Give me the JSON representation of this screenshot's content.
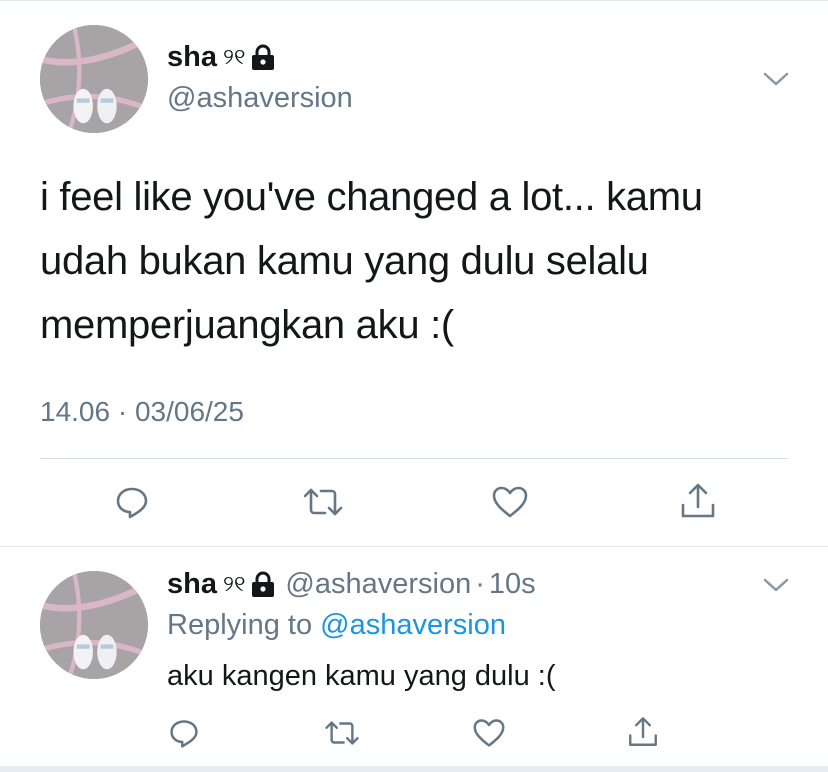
{
  "main_tweet": {
    "display_name": "sha",
    "name_decoration": "୨୧",
    "handle": "@ashaversion",
    "text": "i feel like you've changed a lot... kamu udah bukan kamu yang dulu selalu memperjuangkan aku :(",
    "timestamp": "14.06 · 03/06/25",
    "icons": {
      "lock": "lock-icon",
      "menu": "chevron-down-icon",
      "reply": "reply-icon",
      "retweet": "retweet-icon",
      "like": "heart-icon",
      "share": "share-icon"
    }
  },
  "reply_tweet": {
    "display_name": "sha",
    "name_decoration": "୨୧",
    "handle": "@ashaversion",
    "separator": "·",
    "time_ago": "10s",
    "replying_prefix": "Replying to",
    "replying_to": "@ashaversion",
    "text": "aku kangen kamu yang dulu :("
  },
  "colors": {
    "text_primary": "#14171a",
    "text_secondary": "#657786",
    "link": "#1b95e0",
    "divider": "#e1e8ed"
  }
}
